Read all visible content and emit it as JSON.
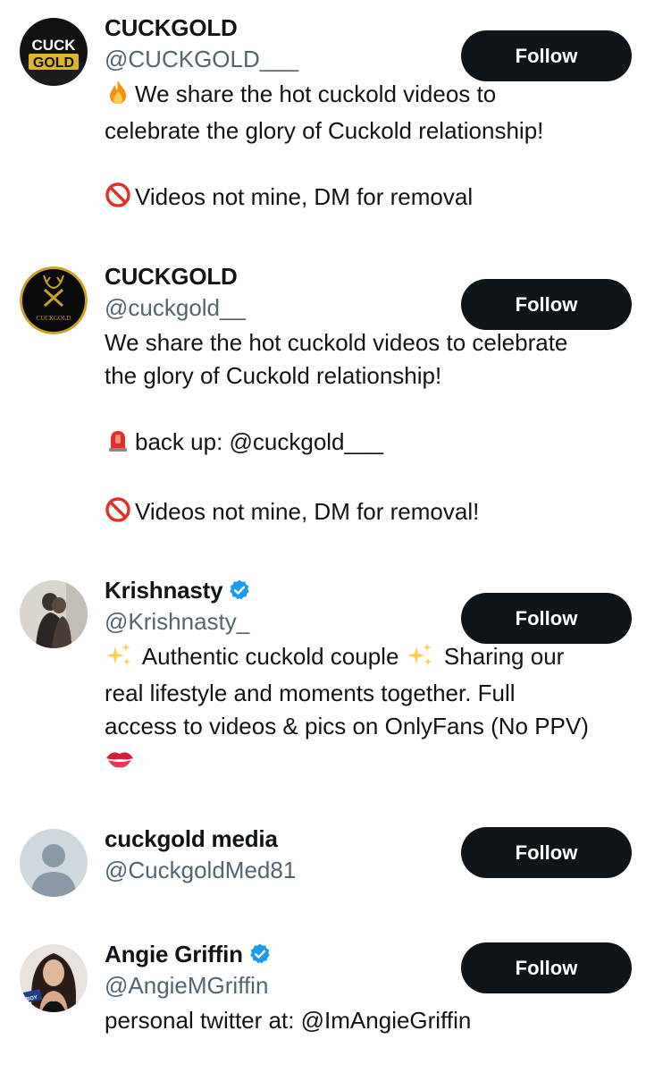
{
  "follow_label": "Follow",
  "users": [
    {
      "name": "CUCKGOLD",
      "handle": "@CUCKGOLD___",
      "avatar_text_top": "CUCK",
      "avatar_text_bottom": "GOLD",
      "bio": [
        "We share the hot cuckold videos to",
        "celebrate the glory of Cuckold relationship!",
        "",
        "Videos not mine, DM for removal"
      ]
    },
    {
      "name": "CUCKGOLD",
      "handle": "@cuckgold__",
      "avatar_text": "CUCKGOLD",
      "bio": [
        "We share the hot cuckold videos to celebrate",
        "the glory of Cuckold relationship!",
        "",
        "back up: @cuckgold___",
        "",
        "Videos not mine, DM for removal!"
      ]
    },
    {
      "name": "Krishnasty",
      "handle": "@Krishnasty_",
      "verified": true,
      "bio": [
        "Authentic cuckold couple",
        "Sharing our",
        "real lifestyle and moments together. Full",
        "access to videos & pics on OnlyFans (No PPV)"
      ]
    },
    {
      "name": "cuckgold media",
      "handle": "@CuckgoldMed81",
      "bio": []
    },
    {
      "name": "Angie Griffin",
      "handle": "@AngieMGriffin",
      "verified": true,
      "avatar_text": "BOY",
      "bio": [
        "personal twitter at: @ImAngieGriffin"
      ]
    }
  ],
  "icons": {
    "fire": "fire-emoji",
    "prohibited": "prohibited-emoji",
    "siren": "siren-emoji",
    "sparkles": "sparkles-emoji",
    "kiss": "kiss-mark-emoji",
    "verified": "verified-badge-icon"
  },
  "colors": {
    "follow_bg": "#0f1419",
    "handle": "#536471",
    "verified": "#1d9bf0",
    "gold": "#e0b52b"
  }
}
